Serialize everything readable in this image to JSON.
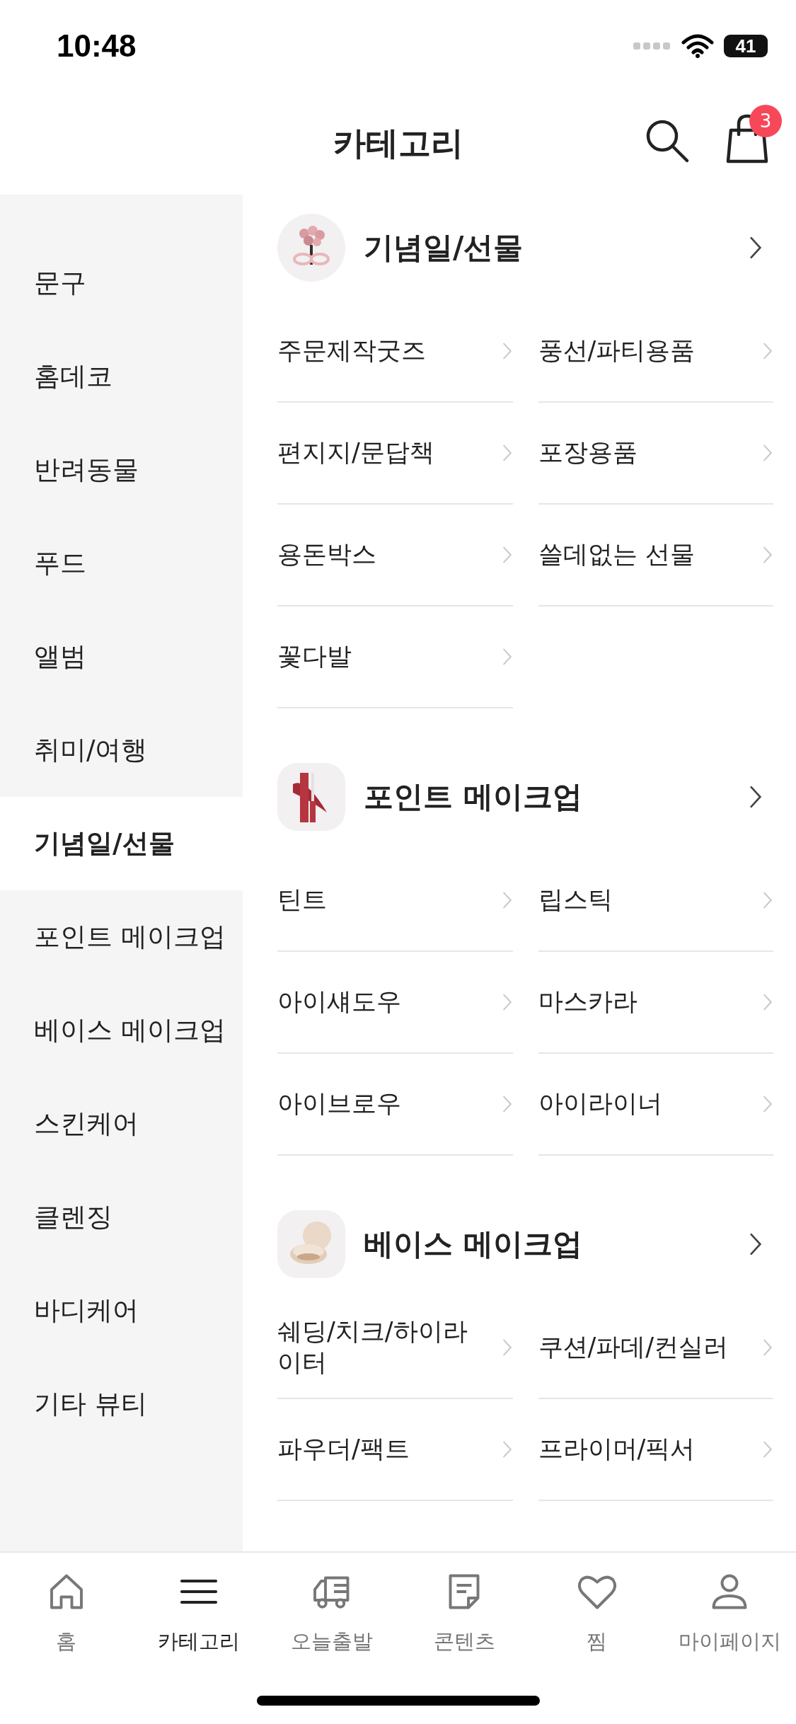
{
  "status_bar": {
    "time": "10:48",
    "battery": "41"
  },
  "header": {
    "title": "카테고리",
    "cart_count": "3"
  },
  "sidebar": {
    "items": [
      {
        "label": "문구",
        "selected": false
      },
      {
        "label": "홈데코",
        "selected": false
      },
      {
        "label": "반려동물",
        "selected": false
      },
      {
        "label": "푸드",
        "selected": false
      },
      {
        "label": "앨범",
        "selected": false
      },
      {
        "label": "취미/여행",
        "selected": false
      },
      {
        "label": "기념일/선물",
        "selected": true
      },
      {
        "label": "포인트 메이크업",
        "selected": false
      },
      {
        "label": "베이스 메이크업",
        "selected": false
      },
      {
        "label": "스킨케어",
        "selected": false
      },
      {
        "label": "클렌징",
        "selected": false
      },
      {
        "label": "바디케어",
        "selected": false
      },
      {
        "label": "기타 뷰티",
        "selected": false
      }
    ]
  },
  "sections": [
    {
      "title": "기념일/선물",
      "kind": "bouquet",
      "items": [
        "주문제작굿즈",
        "풍선/파티용품",
        "편지지/문답책",
        "포장용품",
        "용돈박스",
        "쓸데없는 선물",
        "꽃다발"
      ]
    },
    {
      "title": "포인트 메이크업",
      "kind": "lipstick",
      "items": [
        "틴트",
        "립스틱",
        "아이섀도우",
        "마스카라",
        "아이브로우",
        "아이라이너"
      ]
    },
    {
      "title": "베이스 메이크업",
      "kind": "compact",
      "items": [
        "쉐딩/치크/하이라이터",
        "쿠션/파데/컨실러",
        "파우더/팩트",
        "프라이머/픽서"
      ]
    }
  ],
  "tab_bar": [
    {
      "label": "홈",
      "kind": "home",
      "selected": false
    },
    {
      "label": "카테고리",
      "kind": "menu",
      "selected": true
    },
    {
      "label": "오늘출발",
      "kind": "truck",
      "selected": false
    },
    {
      "label": "콘텐츠",
      "kind": "note",
      "selected": false
    },
    {
      "label": "찜",
      "kind": "heart",
      "selected": false
    },
    {
      "label": "마이페이지",
      "kind": "person",
      "selected": false
    }
  ]
}
